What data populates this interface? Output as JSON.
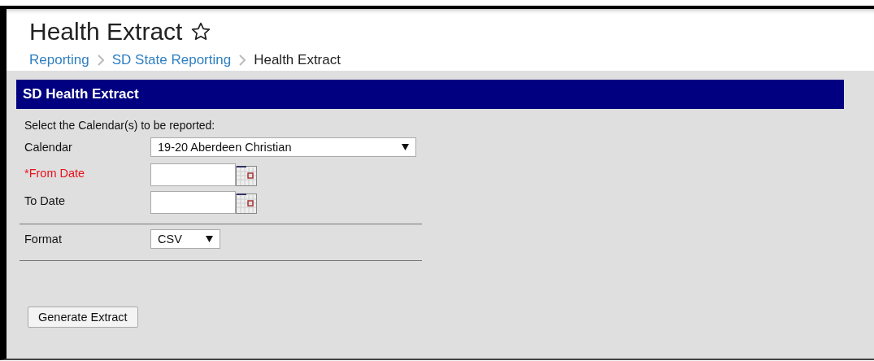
{
  "page": {
    "title": "Health Extract",
    "favorite": false
  },
  "breadcrumb": [
    {
      "label": "Reporting",
      "kind": "link"
    },
    {
      "label": "SD State Reporting",
      "kind": "link"
    },
    {
      "label": "Health Extract",
      "kind": "current"
    }
  ],
  "panel": {
    "title": "SD Health Extract",
    "instruction": "Select the Calendar(s) to be reported:",
    "field_groups": [
      [
        {
          "kind": "select",
          "label": "Calendar",
          "value": "19-20 Aberdeen Christian",
          "required": false,
          "wide": true
        },
        {
          "kind": "date",
          "label": "*From Date",
          "required": true
        },
        {
          "kind": "date",
          "label": "To Date",
          "required": false
        }
      ],
      [
        {
          "kind": "select",
          "label": "Format",
          "value": "CSV",
          "required": false,
          "wide": false
        }
      ]
    ],
    "button": "Generate Extract"
  }
}
